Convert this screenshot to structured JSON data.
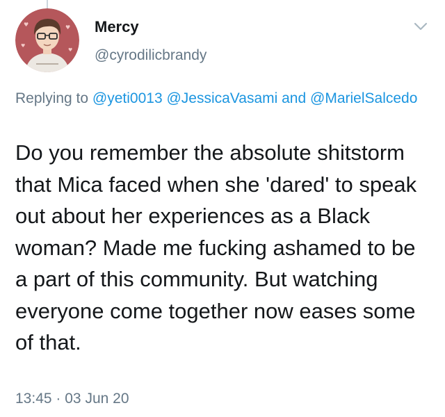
{
  "author": {
    "display_name": "Mercy",
    "handle": "@cyrodilicbrandy",
    "avatar": "avatar-illustration"
  },
  "reply": {
    "prefix": "Replying to",
    "mentions": [
      "@yeti0013",
      "@JessicaVasami",
      "@MarielSalcedo"
    ],
    "conjunction": "and"
  },
  "tweet": {
    "text": "Do you remember the absolute shitstorm that Mica faced when she 'dared' to speak out about her experiences as a Black woman? Made me fucking ashamed to be a part of this community. But watching everyone come together now eases some of that."
  },
  "meta": {
    "time": "13:45",
    "separator": "·",
    "date": "03 Jun 20"
  },
  "icons": {
    "more": "chevron-down-icon"
  },
  "colors": {
    "link": "#1b95e0",
    "secondary_text": "#657786",
    "primary_text": "#14171a",
    "avatar_background": "#b5575b"
  }
}
